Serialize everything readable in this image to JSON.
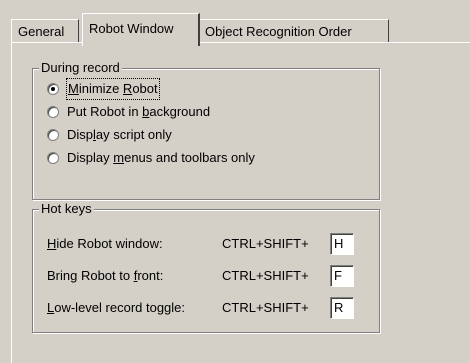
{
  "tabs": [
    {
      "label": "General"
    },
    {
      "label": "Robot Window"
    },
    {
      "label": "Object Recognition Order"
    }
  ],
  "during_record": {
    "legend": "During record",
    "options": [
      {
        "pre": "",
        "key": "M",
        "post": "inimize ",
        "key2": "R",
        "post2": "obot",
        "checked": true
      },
      {
        "pre": "Put Robot in ",
        "key": "b",
        "post": "ackground",
        "checked": false
      },
      {
        "pre": "Disp",
        "key": "l",
        "post": "ay script only",
        "checked": false
      },
      {
        "pre": "Display ",
        "key": "m",
        "post": "enus and toolbars only",
        "checked": false
      }
    ]
  },
  "hot_keys": {
    "legend": "Hot keys",
    "rows": [
      {
        "pre": "",
        "key": "H",
        "post": "ide Robot window:",
        "prefix": "CTRL+SHIFT+",
        "value": "H"
      },
      {
        "pre": "Bring Robot to ",
        "key": "f",
        "post": "ront:",
        "prefix": "CTRL+SHIFT+",
        "value": "F"
      },
      {
        "pre": "",
        "key": "L",
        "post": "ow-level record toggle:",
        "prefix": "CTRL+SHIFT+",
        "value": "R"
      }
    ]
  }
}
